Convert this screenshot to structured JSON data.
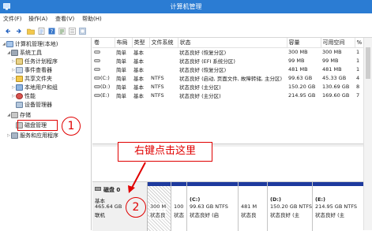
{
  "window": {
    "title": "计算机管理"
  },
  "menu": [
    "文件(F)",
    "操作(A)",
    "查看(V)",
    "帮助(H)"
  ],
  "toolbar": {
    "buttons": [
      "back-arrow-icon",
      "forward-arrow-icon",
      "folder-icon",
      "properties-icon",
      "help-icon",
      "refresh-icon",
      "export-list-icon",
      "settings-icon"
    ]
  },
  "tree": {
    "items": [
      {
        "label": "计算机管理(本地)",
        "icon": "computer-icon"
      },
      {
        "label": "系统工具",
        "icon": "tools-icon"
      },
      {
        "label": "任务计划程序",
        "icon": "clock-icon"
      },
      {
        "label": "事件查看器",
        "icon": "event-viewer-icon"
      },
      {
        "label": "共享文件夹",
        "icon": "shared-folder-icon"
      },
      {
        "label": "本地用户和组",
        "icon": "users-icon"
      },
      {
        "label": "性能",
        "icon": "performance-icon"
      },
      {
        "label": "设备管理器",
        "icon": "device-manager-icon"
      },
      {
        "label": "存储",
        "icon": "storage-icon"
      },
      {
        "label": "磁盘管理",
        "icon": "disk-management-icon"
      },
      {
        "label": "服务和应用程序",
        "icon": "services-icon"
      }
    ]
  },
  "volumes": {
    "headers": [
      "卷",
      "布局",
      "类型",
      "文件系统",
      "状态",
      "容量",
      "可用空间",
      "%"
    ],
    "rows": [
      [
        "",
        "简单",
        "基本",
        "",
        "状态良好 (恢复分区)",
        "300 MB",
        "300 MB",
        "1"
      ],
      [
        "",
        "简单",
        "基本",
        "",
        "状态良好 (EFI 系统分区)",
        "99 MB",
        "99 MB",
        "1"
      ],
      [
        "",
        "简单",
        "基本",
        "",
        "状态良好 (恢复分区)",
        "481 MB",
        "481 MB",
        "1"
      ],
      [
        "(C:)",
        "简单",
        "基本",
        "NTFS",
        "状态良好 (启动, 页面文件, 故障转储, 主分区)",
        "99.63 GB",
        "45.33 GB",
        "4"
      ],
      [
        "(D:)",
        "简单",
        "基本",
        "NTFS",
        "状态良好 (主分区)",
        "150.20 GB",
        "130.69 GB",
        "8"
      ],
      [
        "(E:)",
        "简单",
        "基本",
        "NTFS",
        "状态良好 (主分区)",
        "214.95 GB",
        "169.60 GB",
        "7"
      ]
    ]
  },
  "disk": {
    "name": "磁盘 0",
    "type": "基本",
    "size": "465.64 GB",
    "status": "联机",
    "partitions": [
      {
        "lines": [
          "300 M",
          "状态良"
        ]
      },
      {
        "lines": [
          "100",
          "状态"
        ]
      },
      {
        "lines": [
          "(C:)",
          "99.63 GB NTFS",
          "状态良好 (启"
        ]
      },
      {
        "lines": [
          "481 M",
          "状态良"
        ]
      },
      {
        "lines": [
          "(D:)",
          "150.20 GB NTFS",
          "状态良好 (主"
        ]
      },
      {
        "lines": [
          "(E:)",
          "214.95 GB NTFS",
          "状态良好 (主"
        ]
      }
    ]
  },
  "annotations": {
    "step1": "1",
    "step2": "2",
    "callout": "右键点击这里"
  },
  "colors": {
    "titlebar": "#2b7cd3",
    "partition_bar": "#1e3a9e",
    "annotation": "#e00000"
  }
}
